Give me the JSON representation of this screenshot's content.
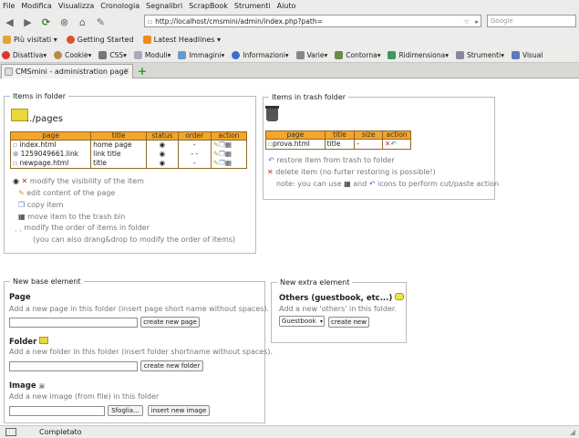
{
  "menu": [
    "File",
    "Modifica",
    "Visualizza",
    "Cronologia",
    "Segnalibri",
    "ScrapBook",
    "Strumenti",
    "Aiuto"
  ],
  "nav": {
    "url": "http://localhost/cmsmini/admin/index.php?path=",
    "search_placeholder": "Google"
  },
  "bookmarks": [
    "Più visitati",
    "Getting Started",
    "Latest Headlines"
  ],
  "toolbar": [
    "Disattiva",
    "Cookie",
    "CSS",
    "Moduli",
    "Immagini",
    "Informazioni",
    "Varie",
    "Contorna",
    "Ridimensiona",
    "Strumenti",
    "Visual"
  ],
  "tab": {
    "title": "CMSmini - administration page"
  },
  "items_folder": {
    "legend": "Items in folder",
    "path": "../pages",
    "headers": [
      "page",
      "title",
      "status",
      "order",
      "action"
    ],
    "rows": [
      {
        "page": "index.html",
        "title": "home page",
        "order": "-"
      },
      {
        "page": "1259049661.link",
        "title": "link title",
        "order": "- -"
      },
      {
        "page": "newpage.html",
        "title": "title",
        "order": "-"
      }
    ],
    "legend_lines": [
      "modify the visibility of the item",
      "edit content of the page",
      "copy item",
      "move item to the trash bin",
      "modify the order of items in folder",
      "(you can also drang&drop to modify the order of items)"
    ]
  },
  "trash": {
    "legend": "Items in trash folder",
    "headers": [
      "page",
      "title",
      "size",
      "action"
    ],
    "row": {
      "page": "prova.html",
      "title": "title",
      "size": "-"
    },
    "lines": [
      "restore item from trash to folder",
      "delete item (no furter restoring is possible!)",
      "note: you can use",
      "and",
      "icons to perform cut/paste action"
    ]
  },
  "new_base": {
    "legend": "New base element",
    "page": {
      "title": "Page",
      "desc": "Add a new page in this folder (insert page short name without spaces).",
      "button": "create new page"
    },
    "folder": {
      "title": "Folder",
      "desc": "Add a new folder in this folder (insert folder shortname without spaces).",
      "button": "create new folder"
    },
    "image": {
      "title": "Image",
      "desc": "Add a new image (from file) in this folder",
      "browse": "Sfoglia...",
      "button": "insert new image"
    }
  },
  "new_extra": {
    "legend": "New extra element",
    "title": "Others (guestbook, etc...)",
    "desc": "Add a new 'others' in this folder.",
    "select": "Guestbook",
    "button": "create new"
  },
  "status": {
    "text": "Completato"
  },
  "colors": {
    "table_header": "#f4a52a",
    "chrome": "#edeceb"
  }
}
